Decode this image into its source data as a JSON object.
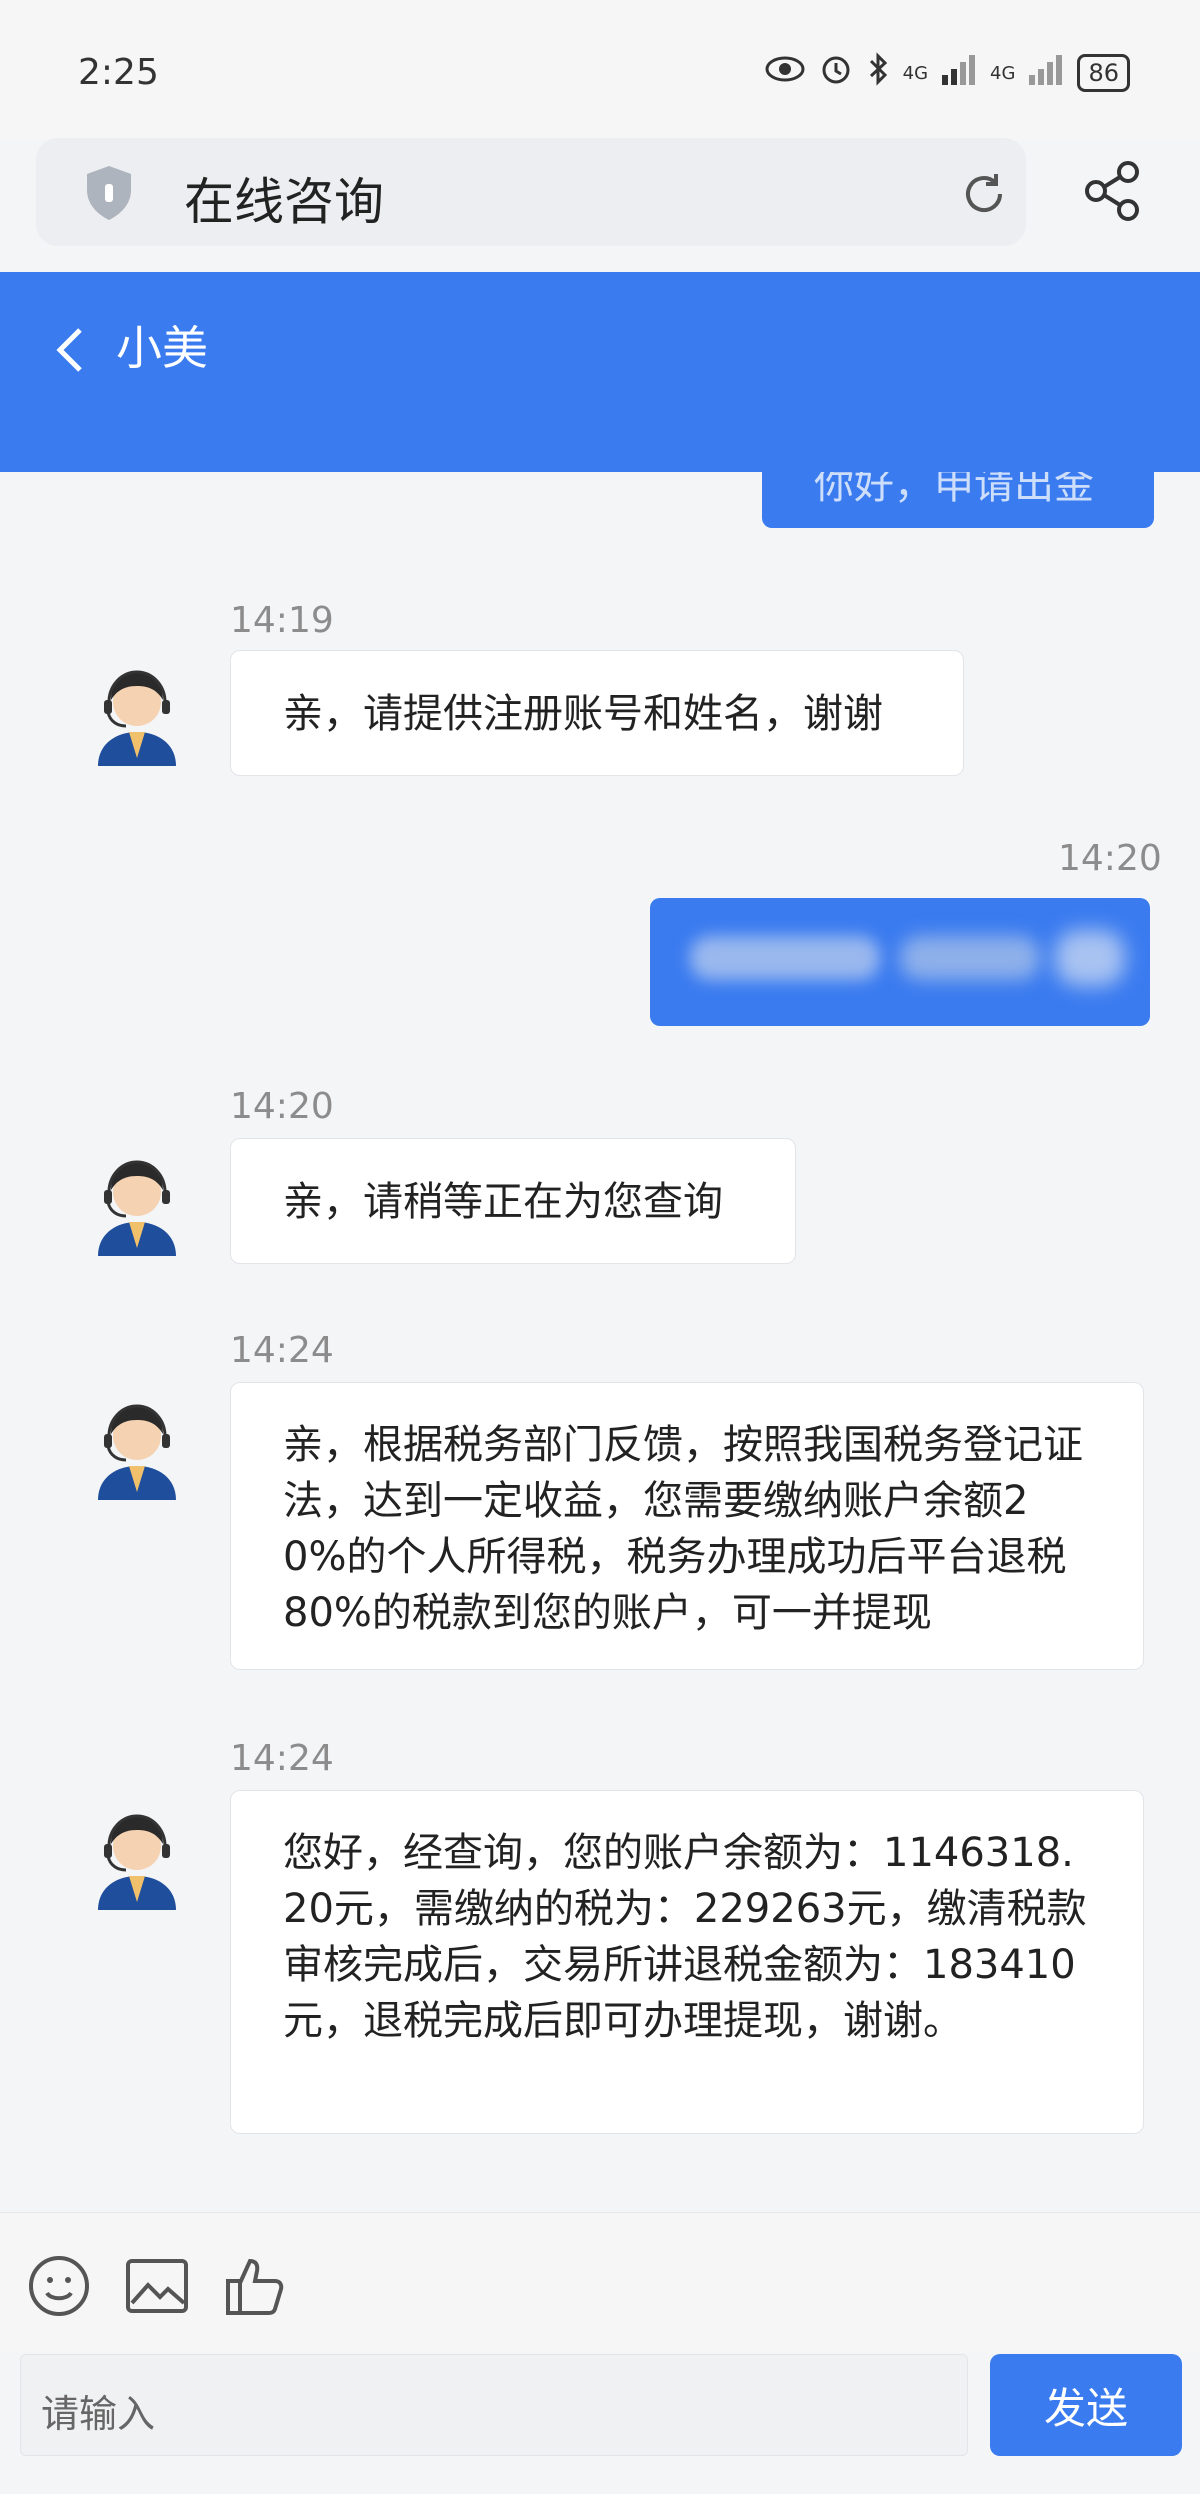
{
  "status_bar": {
    "time": "2:25",
    "signal_1": "4G",
    "signal_2": "4G",
    "battery": "86"
  },
  "browser": {
    "title": "在线咨询"
  },
  "chat_header": {
    "contact_name": "小美"
  },
  "truncated_message": {
    "text": "你好，申请出金"
  },
  "messages": [
    {
      "time": "14:19",
      "text": "亲，请提供注册账号和姓名，谢谢"
    },
    {
      "time": "14:20",
      "text": "亲，请稍等正在为您查询"
    },
    {
      "time": "14:24",
      "text": "亲，根据税务部门反馈，按照我国税务登记证法，达到一定收益，您需要缴纳账户余额20%的个人所得税，税务办理成功后平台退税80%的税款到您的账户，可一并提现"
    },
    {
      "time": "14:24",
      "text": "您好，经查询，您的账户余额为：1146318.20元，需缴纳的税为：229263元，缴清税款审核完成后，交易所讲退税金额为：183410元，退税完成后即可办理提现，谢谢。"
    }
  ],
  "outgoing_message": {
    "time": "14:20"
  },
  "input": {
    "placeholder": "请输入",
    "send_label": "发送"
  },
  "colors": {
    "accent": "#3a7bf0",
    "background": "#f4f5f7"
  }
}
